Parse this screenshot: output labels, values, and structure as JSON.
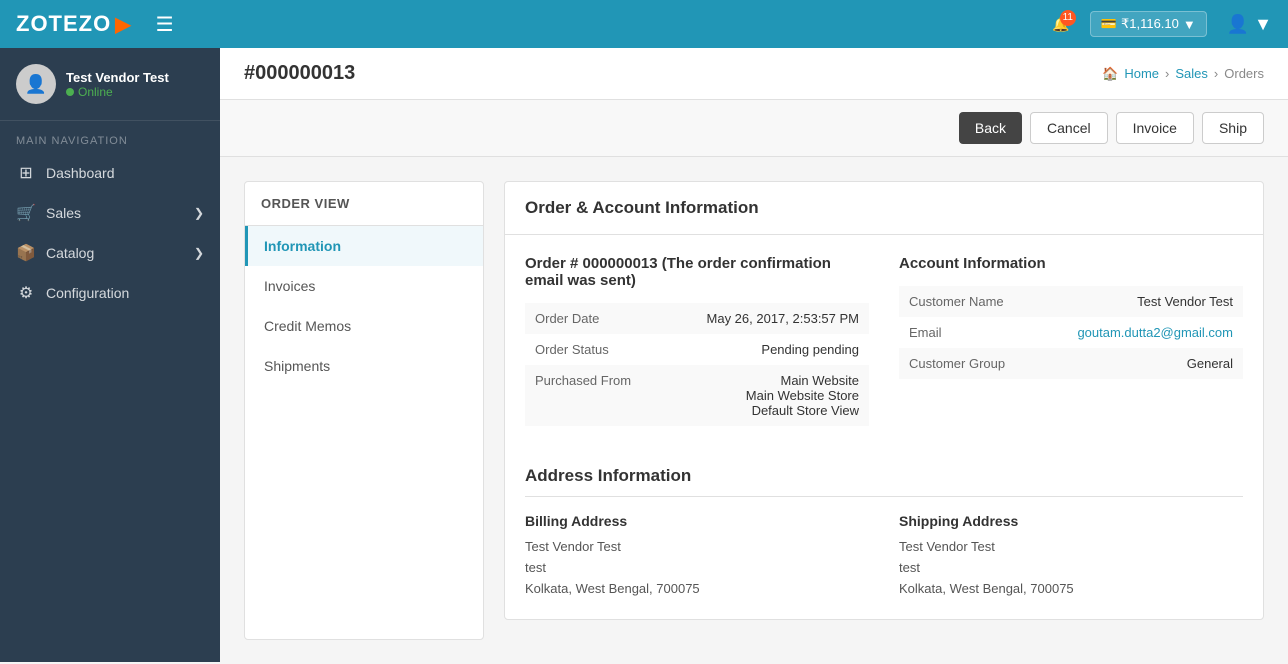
{
  "header": {
    "logo_text": "ZOTEZO",
    "hamburger_icon": "☰",
    "notification_count": "11",
    "balance": "₹1,116.10",
    "user_icon": "▼"
  },
  "sidebar": {
    "user_name": "Test Vendor Test",
    "user_status": "Online",
    "nav_label": "MAIN NAVIGATION",
    "nav_items": [
      {
        "label": "Dashboard",
        "icon": "⊞"
      },
      {
        "label": "Sales",
        "icon": "🛒",
        "has_arrow": true
      },
      {
        "label": "Catalog",
        "icon": "📦",
        "has_arrow": true
      },
      {
        "label": "Configuration",
        "icon": "⚙"
      }
    ]
  },
  "page": {
    "title": "#000000013",
    "breadcrumb": [
      "Home",
      "Sales",
      "Orders"
    ]
  },
  "toolbar": {
    "back": "Back",
    "cancel": "Cancel",
    "invoice": "Invoice",
    "ship": "Ship"
  },
  "order_view": {
    "header": "ORDER VIEW",
    "items": [
      {
        "label": "Information",
        "active": true
      },
      {
        "label": "Invoices",
        "active": false
      },
      {
        "label": "Credit Memos",
        "active": false
      },
      {
        "label": "Shipments",
        "active": false
      }
    ]
  },
  "main": {
    "order_account_section_title": "Order & Account Information",
    "order_number_text": "Order # 000000013 (The order confirmation email was sent)",
    "order_table": [
      {
        "label": "Order Date",
        "value": "May 26, 2017, 2:53:57 PM"
      },
      {
        "label": "Order Status",
        "value": "Pending pending"
      },
      {
        "label": "Purchased From",
        "value": "Main Website\nMain Website Store\nDefault Store View"
      }
    ],
    "account_info_title": "Account Information",
    "account_table": [
      {
        "label": "Customer Name",
        "value": "Test Vendor Test",
        "link": false
      },
      {
        "label": "Email",
        "value": "goutam.dutta2@gmail.com",
        "link": true
      },
      {
        "label": "Customer Group",
        "value": "General",
        "link": false
      }
    ],
    "address_section_title": "Address Information",
    "billing_address": {
      "title": "Billing Address",
      "lines": [
        "Test Vendor Test",
        "test",
        "Kolkata, West Bengal, 700075"
      ]
    },
    "shipping_address": {
      "title": "Shipping Address",
      "lines": [
        "Test Vendor Test",
        "test",
        "Kolkata, West Bengal, 700075"
      ]
    }
  }
}
